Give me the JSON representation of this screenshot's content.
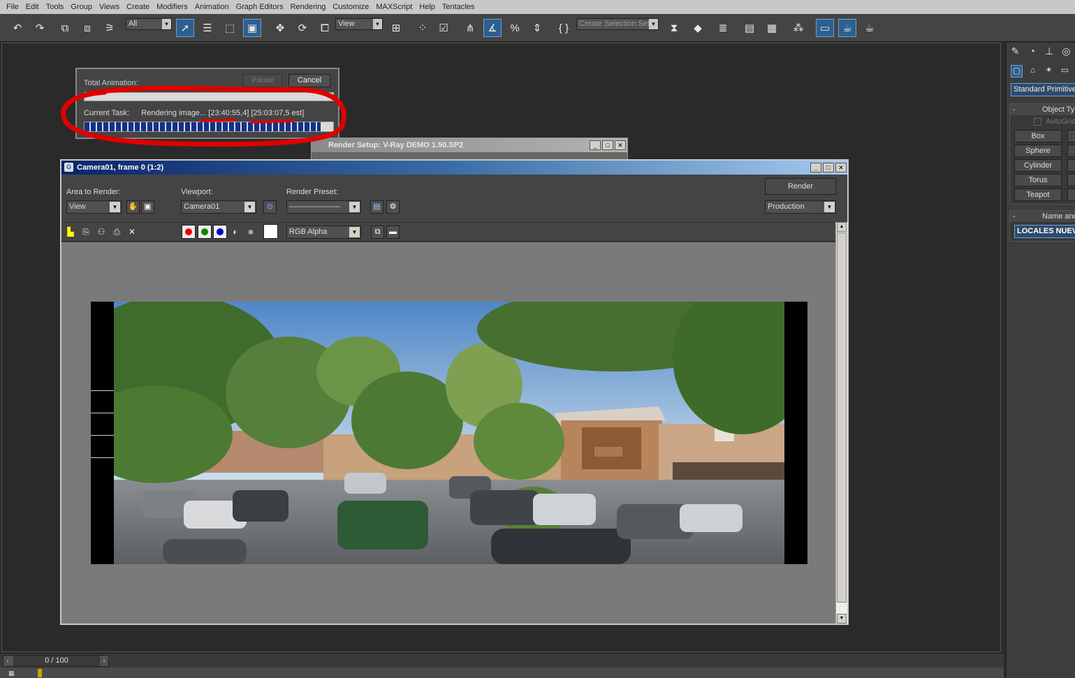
{
  "menu": [
    "File",
    "Edit",
    "Tools",
    "Group",
    "Views",
    "Create",
    "Modifiers",
    "Animation",
    "Graph Editors",
    "Rendering",
    "Customize",
    "MAXScript",
    "Help",
    "Tentacles"
  ],
  "toolbar": {
    "selection_filter": "All",
    "ref_coord": "View",
    "named_selection": "Create Selection Set",
    "icons": [
      "undo-icon",
      "redo-icon",
      "link-icon",
      "unlink-icon",
      "bind-icon",
      "select-icon",
      "select-by-name-icon",
      "rect-region-icon",
      "window-crossing-icon",
      "move-icon",
      "rotate-icon",
      "scale-icon",
      "pivot-icon",
      "snap-icon",
      "angle-snap-icon",
      "percent-snap-icon",
      "spinner-snap-icon",
      "edit-named-sets-icon",
      "mirror-icon",
      "align-icon",
      "layers-icon",
      "curve-editor-icon",
      "schematic-icon",
      "material-editor-icon",
      "render-setup-icon",
      "rendered-frame-icon",
      "quick-render-icon"
    ]
  },
  "progress": {
    "total_label": "Total Animation:",
    "pause": "Pause",
    "cancel": "Cancel",
    "current_label": "Current Task:",
    "task_text": "Rendering image... [23:40:55,4] [25:03:07,5 est]",
    "progress_fraction": 0.95
  },
  "render_setup": {
    "title": "Render Setup: V-Ray DEMO 1.50.SP2"
  },
  "frame_window": {
    "title": "Camera01, frame 0 (1:2)",
    "area_label": "Area to Render:",
    "area_value": "View",
    "viewport_label": "Viewport:",
    "viewport_value": "Camera01",
    "preset_label": "Render Preset:",
    "preset_value": "--------------------",
    "render_button": "Render",
    "mode_value": "Production",
    "channel_value": "RGB Alpha",
    "window_controls": [
      "_",
      "□",
      "X"
    ]
  },
  "command_panel": {
    "dropdown": "Standard Primitives",
    "object_type_header": "Object Ty",
    "autogrid": "AutoGrid",
    "buttons": [
      "Box",
      "Sphere",
      "Cylinder",
      "Torus",
      "Teapot"
    ],
    "name_header": "Name and",
    "name_value": "LOCALES NUEV"
  },
  "timeline": {
    "frame_readout": "0 / 100"
  },
  "colors": {
    "accent": "#2e5f8e",
    "title_start": "#0a246a",
    "title_end": "#a6caf0",
    "progress": "#13308a",
    "annotation": "#e00000"
  }
}
